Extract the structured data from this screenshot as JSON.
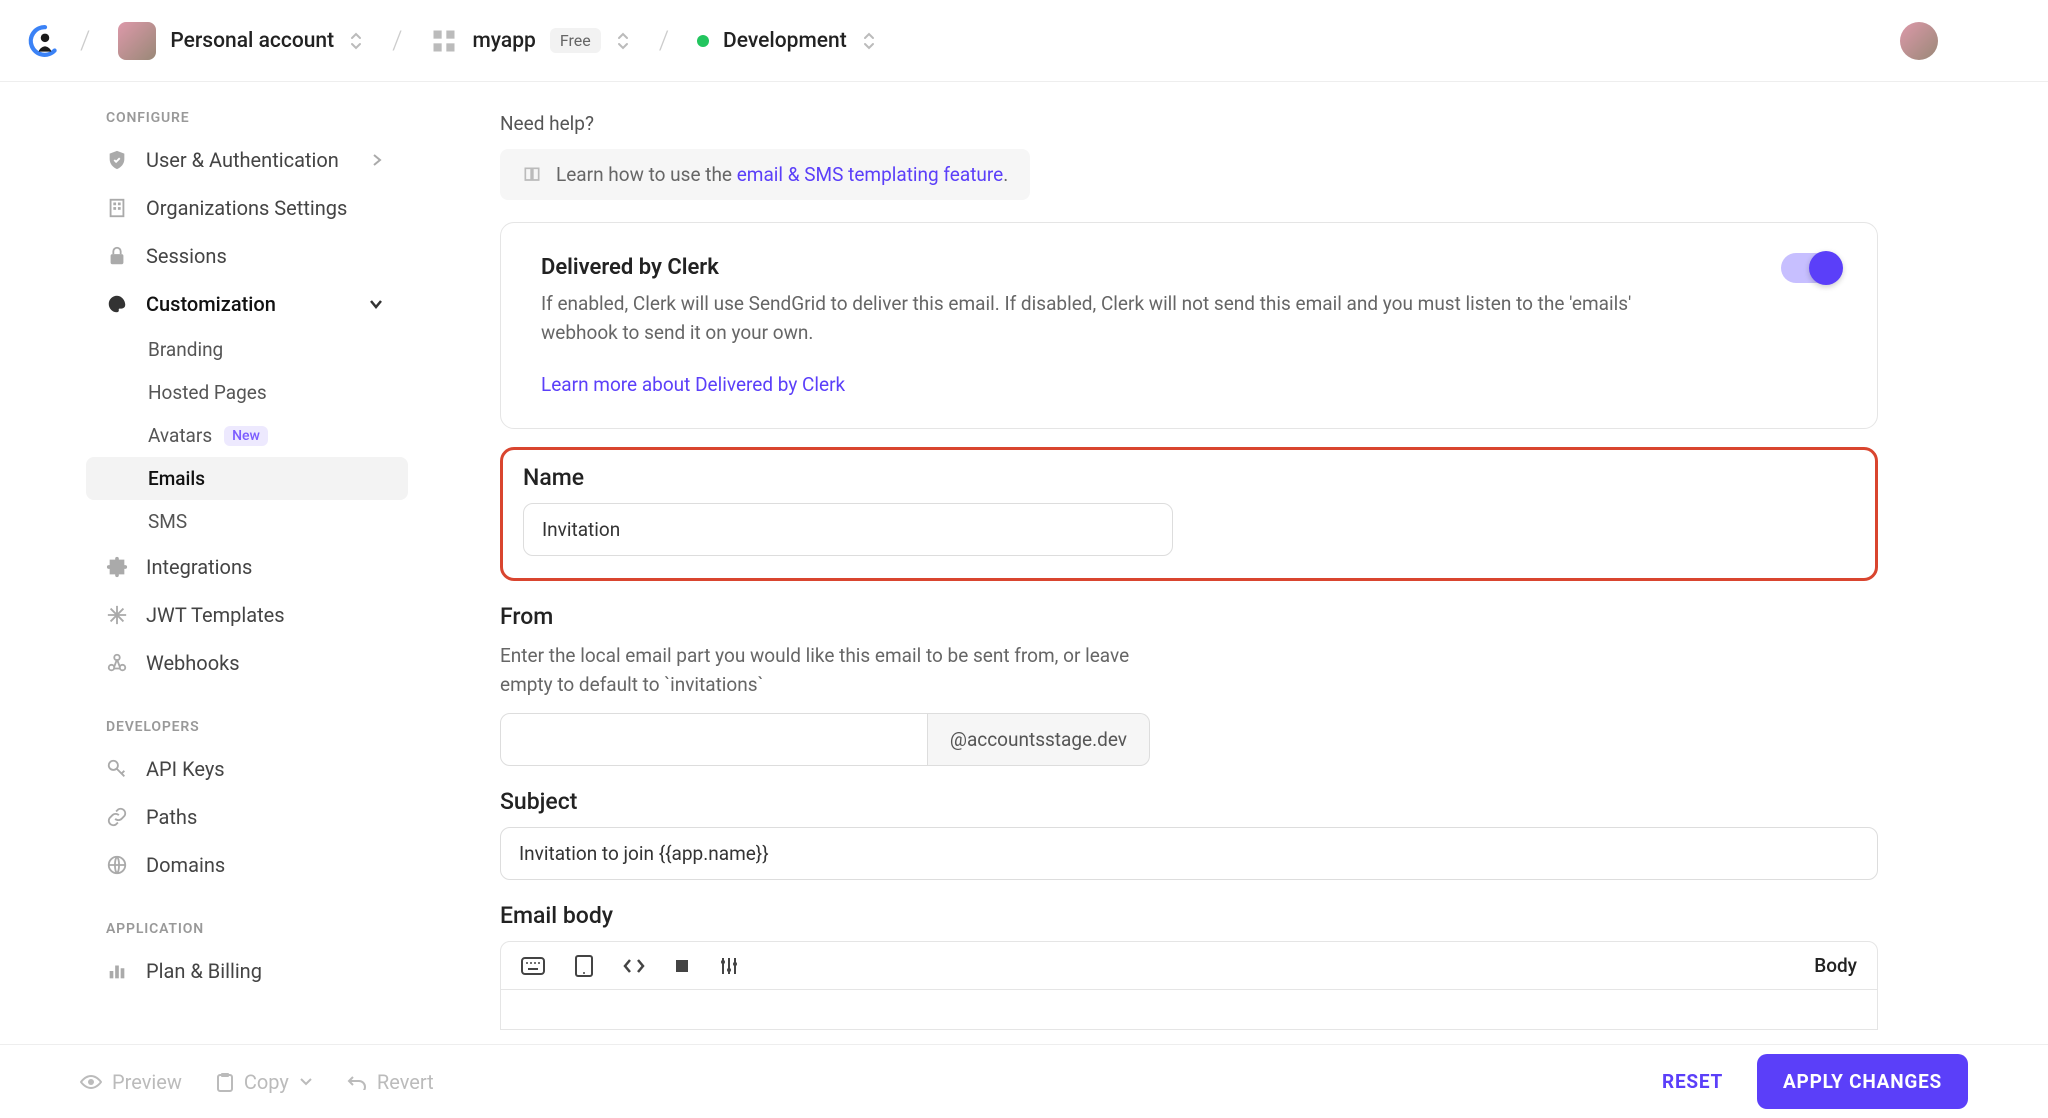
{
  "topbar": {
    "account_label": "Personal account",
    "app_name": "myapp",
    "plan_pill": "Free",
    "env_label": "Development"
  },
  "sidebar": {
    "configure_label": "CONFIGURE",
    "developers_label": "DEVELOPERS",
    "application_label": "APPLICATION",
    "items": {
      "user_auth": "User & Authentication",
      "orgs": "Organizations Settings",
      "sessions": "Sessions",
      "customization": "Customization",
      "integrations": "Integrations",
      "jwt": "JWT Templates",
      "webhooks": "Webhooks",
      "api_keys": "API Keys",
      "paths": "Paths",
      "domains": "Domains",
      "plan_billing": "Plan & Billing"
    },
    "sub": {
      "branding": "Branding",
      "hosted": "Hosted Pages",
      "avatars": "Avatars",
      "avatars_badge": "New",
      "emails": "Emails",
      "sms": "SMS"
    }
  },
  "main": {
    "need_help": "Need help?",
    "help_prefix": "Learn how to use the ",
    "help_link": "email & SMS templating feature",
    "help_suffix": ".",
    "delivered_title": "Delivered by Clerk",
    "delivered_desc": "If enabled, Clerk will use SendGrid to deliver this email. If disabled, Clerk will not send this email and you must listen to the 'emails' webhook to send it on your own.",
    "delivered_learn": "Learn more about Delivered by Clerk",
    "name_label": "Name",
    "name_value": "Invitation",
    "from_label": "From",
    "from_help": "Enter the local email part you would like this email to be sent from, or leave empty to default to `invitations`",
    "from_value": "",
    "from_suffix": "@accountsstage.dev",
    "subject_label": "Subject",
    "subject_value": "Invitation to join {{app.name}}",
    "body_label": "Email body",
    "editor_mode": "Body"
  },
  "footer": {
    "preview": "Preview",
    "copy": "Copy",
    "revert": "Revert",
    "reset": "RESET",
    "apply": "APPLY CHANGES"
  }
}
